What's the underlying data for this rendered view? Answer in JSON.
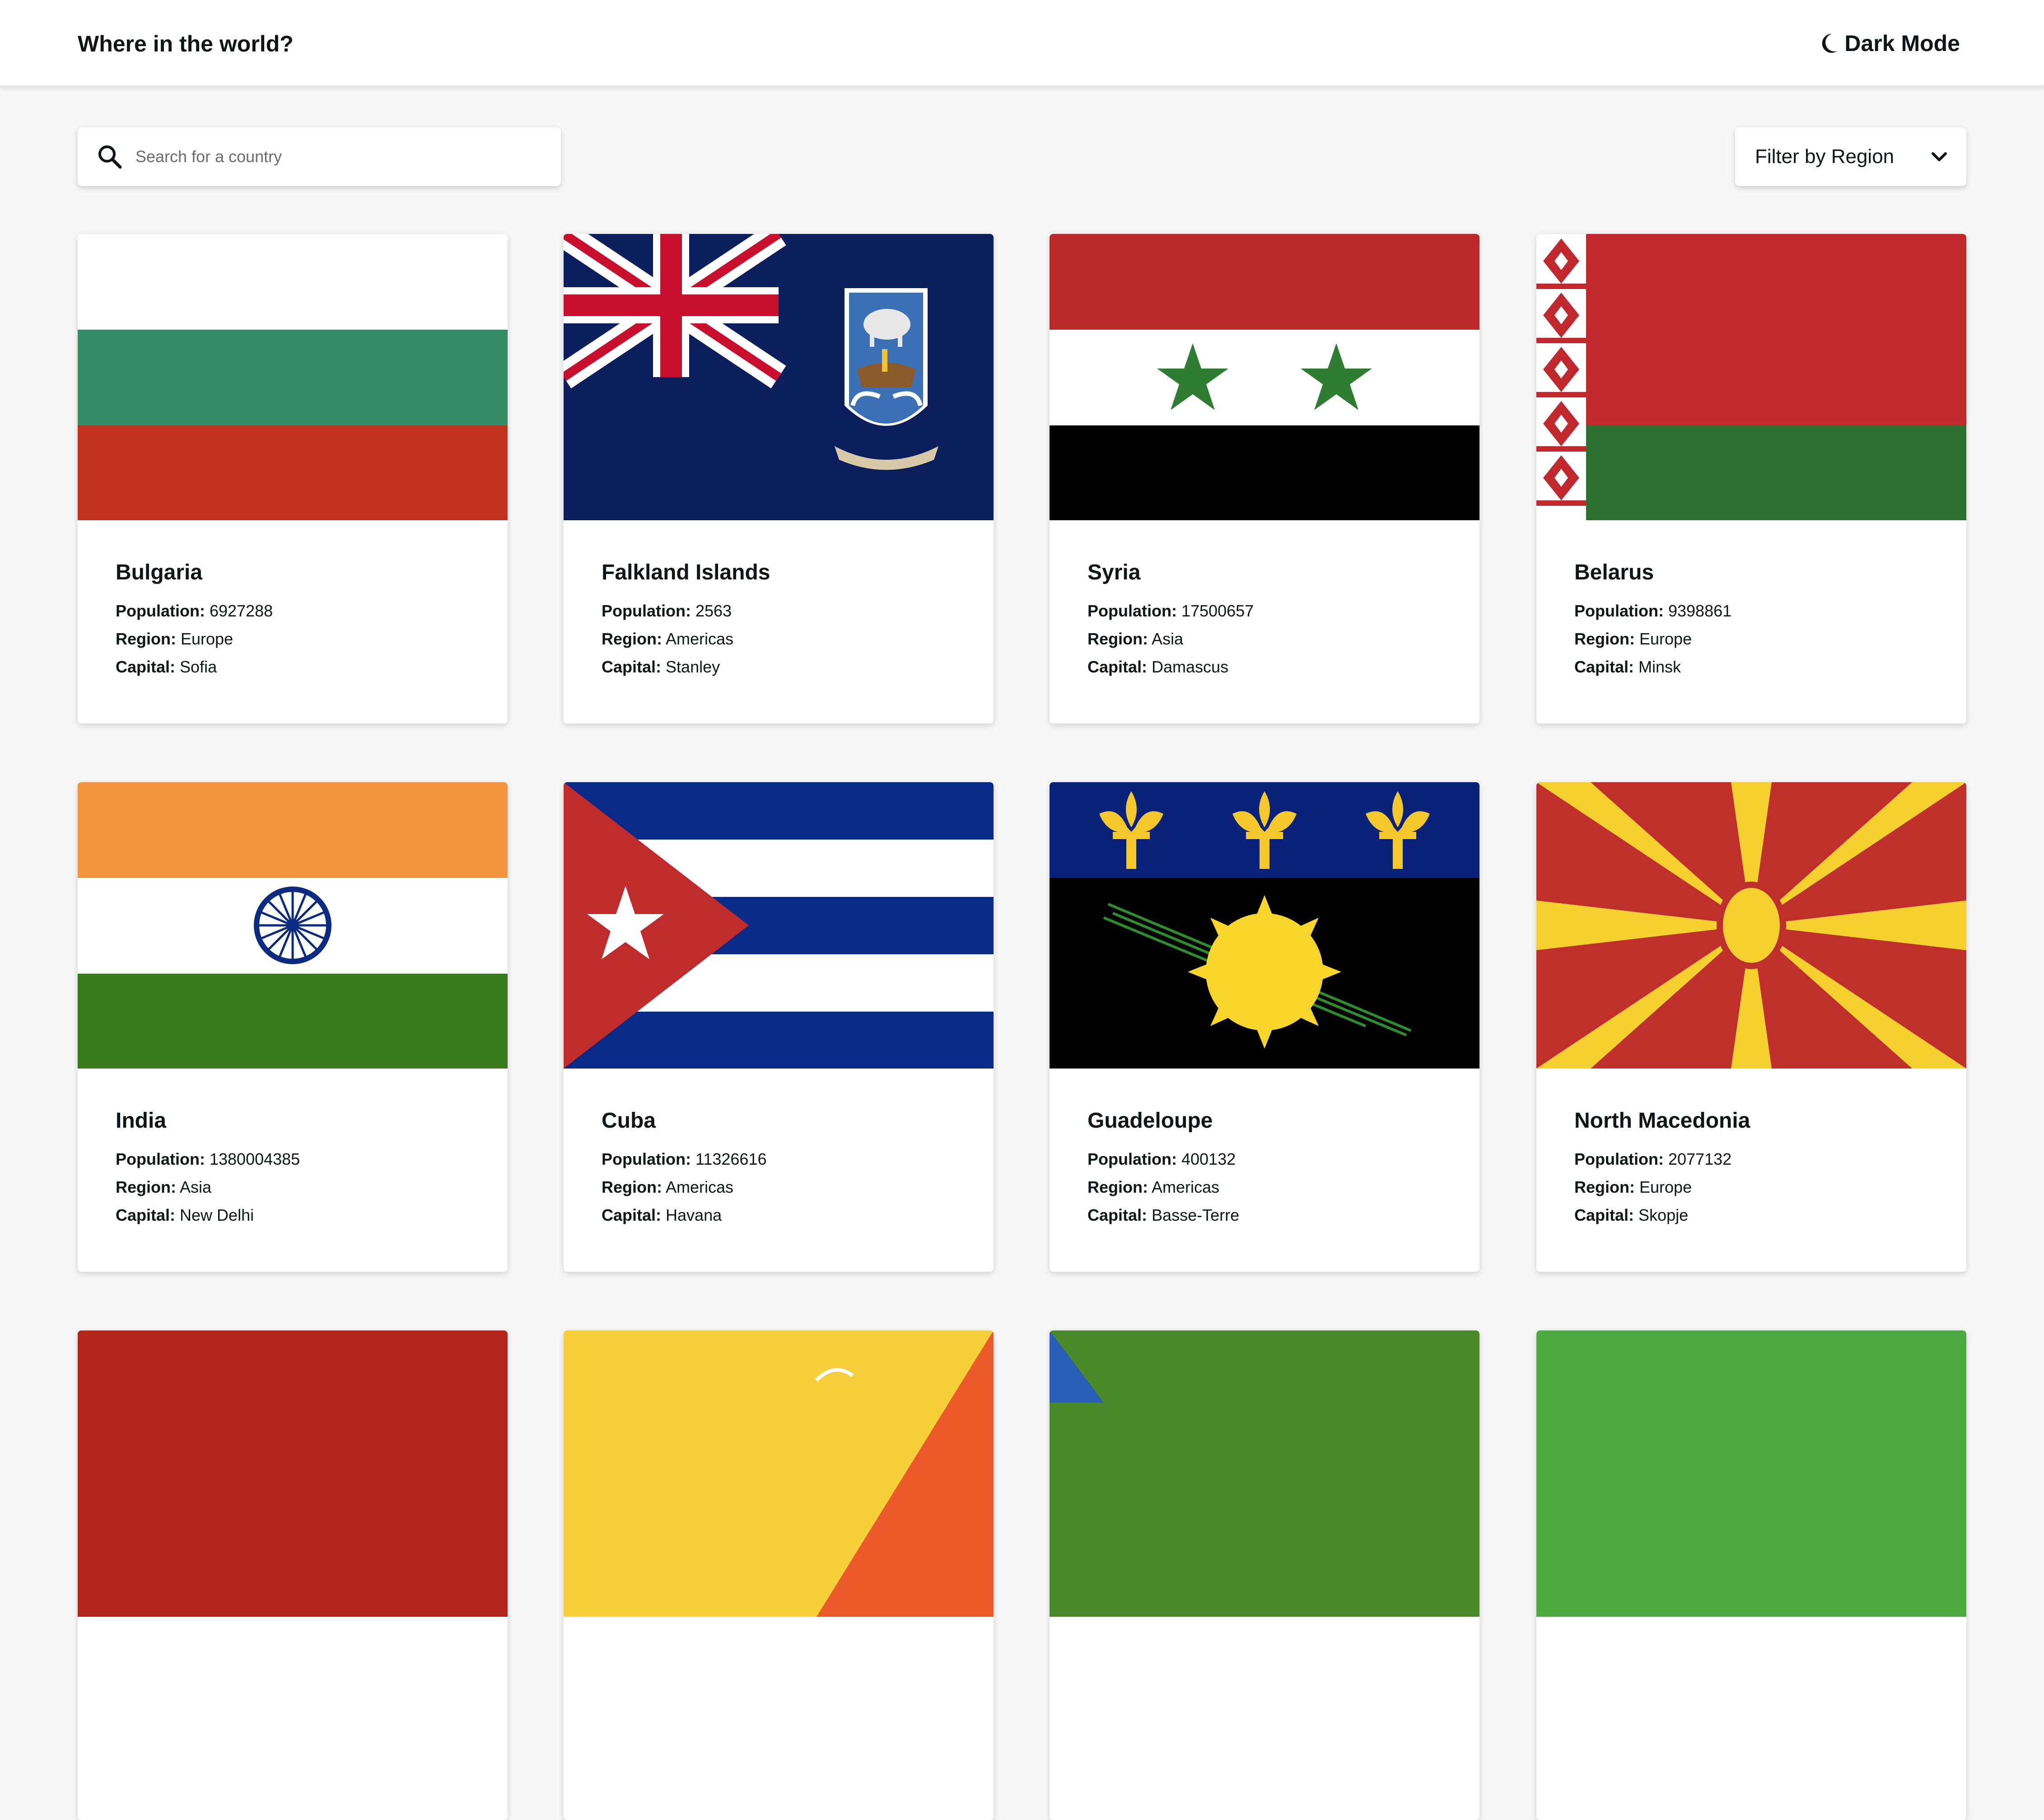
{
  "header": {
    "title": "Where in the world?",
    "theme_toggle": "Dark Mode"
  },
  "search": {
    "placeholder": "Search for a country",
    "value": ""
  },
  "filter": {
    "label": "Filter by Region"
  },
  "labels": {
    "population": "Population:",
    "region": "Region:",
    "capital": "Capital:"
  },
  "countries": [
    {
      "name": "Bulgaria",
      "population": "6927288",
      "region": "Europe",
      "capital": "Sofia"
    },
    {
      "name": "Falkland Islands",
      "population": "2563",
      "region": "Americas",
      "capital": "Stanley"
    },
    {
      "name": "Syria",
      "population": "17500657",
      "region": "Asia",
      "capital": "Damascus"
    },
    {
      "name": "Belarus",
      "population": "9398861",
      "region": "Europe",
      "capital": "Minsk"
    },
    {
      "name": "India",
      "population": "1380004385",
      "region": "Asia",
      "capital": "New Delhi"
    },
    {
      "name": "Cuba",
      "population": "11326616",
      "region": "Americas",
      "capital": "Havana"
    },
    {
      "name": "Guadeloupe",
      "population": "400132",
      "region": "Americas",
      "capital": "Basse-Terre"
    },
    {
      "name": "North Macedonia",
      "population": "2077132",
      "region": "Europe",
      "capital": "Skopje"
    }
  ],
  "colors": {
    "background": "#f7f7f7",
    "surface": "#ffffff",
    "text": "#111517"
  }
}
